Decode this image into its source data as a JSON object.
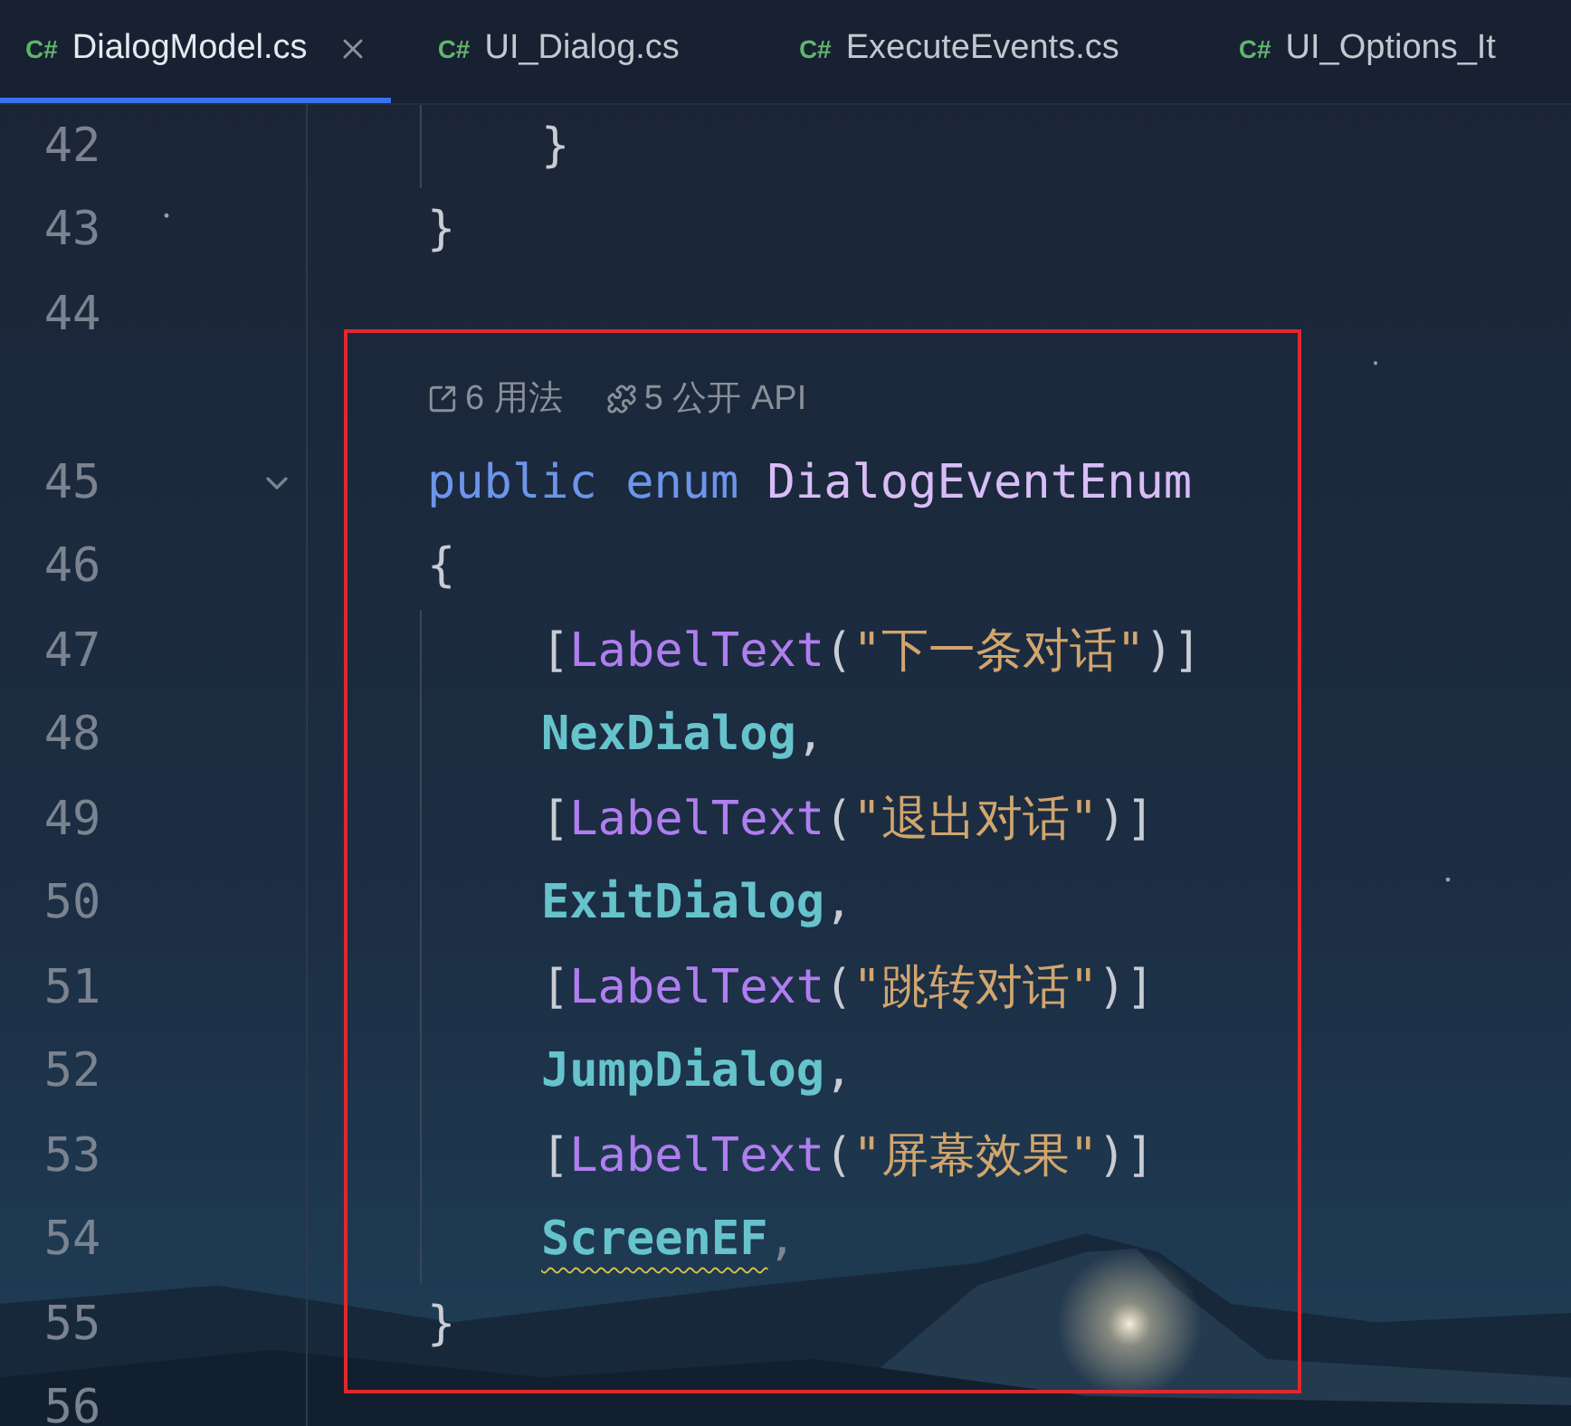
{
  "tabs": [
    {
      "icon_text": "C#",
      "label": "DialogModel.cs",
      "selected": true
    },
    {
      "icon_text": "C#",
      "label": "UI_Dialog.cs",
      "selected": false
    },
    {
      "icon_text": "C#",
      "label": "ExecuteEvents.cs",
      "selected": false
    },
    {
      "icon_text": "C#",
      "label": "UI_Options_It",
      "selected": false
    }
  ],
  "editor": {
    "rows": [
      {
        "kind": "code",
        "number": "42",
        "indented": true,
        "tokens": [
          {
            "kind": "punct",
            "text": "}"
          }
        ]
      },
      {
        "kind": "code",
        "number": "43",
        "tokens": [
          {
            "kind": "punct",
            "text": "}"
          }
        ]
      },
      {
        "kind": "code",
        "number": "44",
        "tokens": []
      },
      {
        "kind": "hints",
        "hints": [
          {
            "kind": "usages",
            "text": "6 用法"
          },
          {
            "kind": "api",
            "text": "5 公开 API"
          }
        ]
      },
      {
        "kind": "code",
        "number": "45",
        "foldable": true,
        "tokens": [
          {
            "kind": "keyword",
            "text": "public enum"
          },
          {
            "kind": "type",
            "text": "DialogEventEnum",
            "space_before": true
          }
        ]
      },
      {
        "kind": "code",
        "number": "46",
        "tokens": [
          {
            "kind": "punct",
            "text": "{"
          }
        ]
      },
      {
        "kind": "code",
        "number": "47",
        "indented": true,
        "tokens": [
          {
            "kind": "punct",
            "text": "["
          },
          {
            "kind": "attribute",
            "text": "LabelText"
          },
          {
            "kind": "punct",
            "text": "("
          },
          {
            "kind": "string",
            "text": "\"下一条对话\""
          },
          {
            "kind": "punct",
            "text": ")]"
          }
        ]
      },
      {
        "kind": "code",
        "number": "48",
        "indented": true,
        "tokens": [
          {
            "kind": "member",
            "text": "NexDialog"
          },
          {
            "kind": "punct",
            "text": ","
          }
        ]
      },
      {
        "kind": "code",
        "number": "49",
        "indented": true,
        "tokens": [
          {
            "kind": "punct",
            "text": "["
          },
          {
            "kind": "attribute",
            "text": "LabelText"
          },
          {
            "kind": "punct",
            "text": "("
          },
          {
            "kind": "string",
            "text": "\"退出对话\""
          },
          {
            "kind": "punct",
            "text": ")]"
          }
        ]
      },
      {
        "kind": "code",
        "number": "50",
        "indented": true,
        "tokens": [
          {
            "kind": "member",
            "text": "ExitDialog"
          },
          {
            "kind": "punct",
            "text": ","
          }
        ]
      },
      {
        "kind": "code",
        "number": "51",
        "indented": true,
        "tokens": [
          {
            "kind": "punct",
            "text": "["
          },
          {
            "kind": "attribute",
            "text": "LabelText"
          },
          {
            "kind": "punct",
            "text": "("
          },
          {
            "kind": "string",
            "text": "\"跳转对话\""
          },
          {
            "kind": "punct",
            "text": ")]"
          }
        ]
      },
      {
        "kind": "code",
        "number": "52",
        "indented": true,
        "tokens": [
          {
            "kind": "member",
            "text": "JumpDialog"
          },
          {
            "kind": "punct",
            "text": ","
          }
        ]
      },
      {
        "kind": "code",
        "number": "53",
        "indented": true,
        "tokens": [
          {
            "kind": "punct",
            "text": "["
          },
          {
            "kind": "attribute",
            "text": "LabelText"
          },
          {
            "kind": "punct",
            "text": "("
          },
          {
            "kind": "string",
            "text": "\"屏幕效果\""
          },
          {
            "kind": "punct",
            "text": ")]"
          }
        ]
      },
      {
        "kind": "code",
        "number": "54",
        "indented": true,
        "tokens": [
          {
            "kind": "member",
            "text": "ScreenEF",
            "warning": true
          },
          {
            "kind": "comma",
            "text": ","
          }
        ]
      },
      {
        "kind": "code",
        "number": "55",
        "tokens": [
          {
            "kind": "punct",
            "text": "}"
          }
        ]
      },
      {
        "kind": "code",
        "number": "56",
        "tokens": []
      }
    ]
  }
}
